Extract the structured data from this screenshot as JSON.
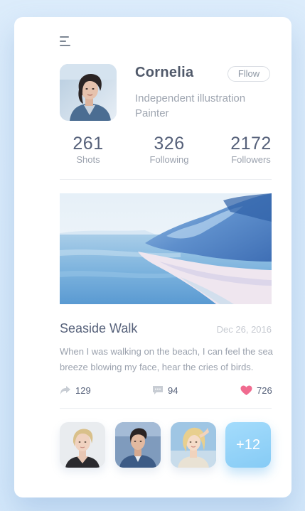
{
  "profile": {
    "name": "Cornelia",
    "follow_label": "Fllow",
    "bio": "Independent illustration Painter"
  },
  "stats": [
    {
      "value": "261",
      "label": "Shots"
    },
    {
      "value": "326",
      "label": "Following"
    },
    {
      "value": "2172",
      "label": "Followers"
    }
  ],
  "post": {
    "title": "Seaside Walk",
    "date": "Dec 26, 2016",
    "body": "When I was walking on the beach, I can feel the sea breeze blowing my face, hear the cries of birds.",
    "shares": "129",
    "comments": "94",
    "likes": "726"
  },
  "followers_preview": {
    "more_label": "+12"
  },
  "colors": {
    "accent": "#8fd0f7",
    "heart": "#f06b8f",
    "text_dark": "#56617a",
    "text_muted": "#9aa1ad"
  },
  "icons": [
    "menu-icon",
    "share-icon",
    "comment-icon",
    "heart-icon"
  ]
}
